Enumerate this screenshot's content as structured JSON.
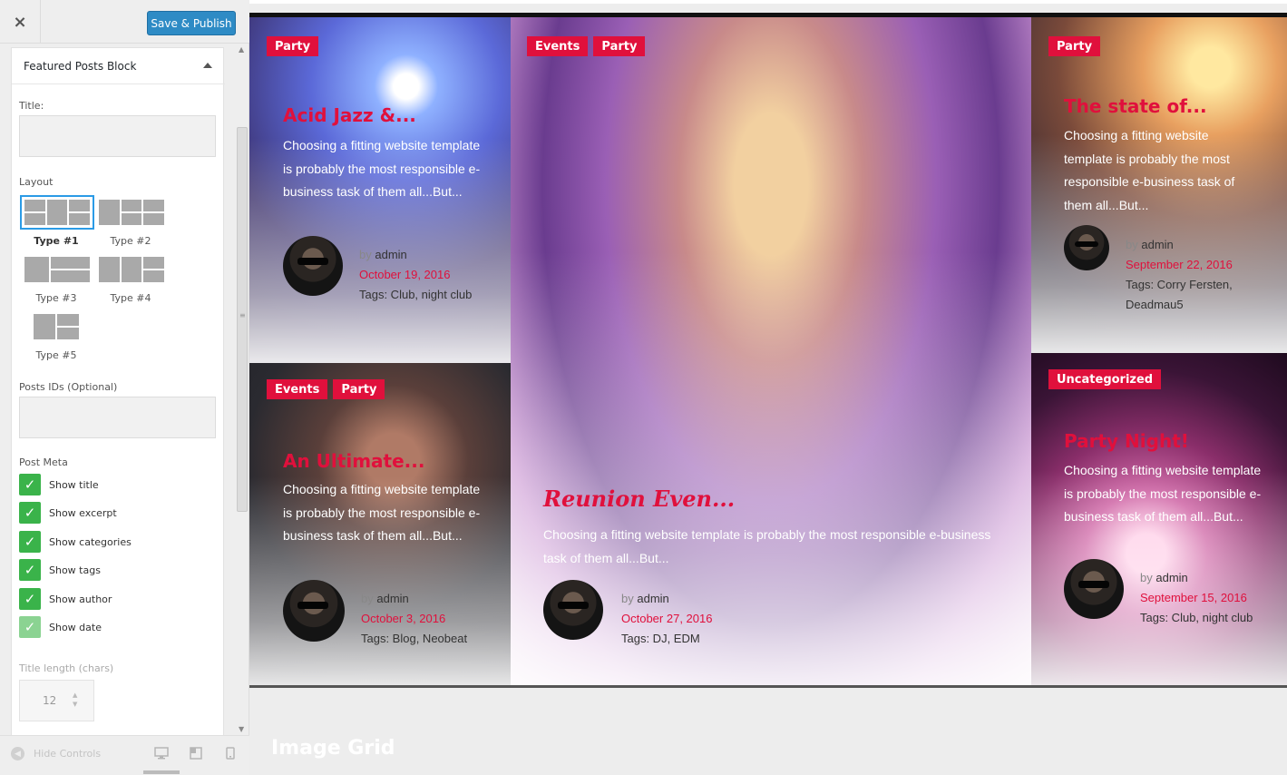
{
  "sidebar": {
    "close_label": "×",
    "publish_label": "Save & Publish",
    "block_title": "Featured Posts Block",
    "title_label": "Title:",
    "title_value": "",
    "layout_label": "Layout",
    "layout_options": [
      {
        "label": "Type #1",
        "selected": true
      },
      {
        "label": "Type #2",
        "selected": false
      },
      {
        "label": "Type #3",
        "selected": false
      },
      {
        "label": "Type #4",
        "selected": false
      },
      {
        "label": "Type #5",
        "selected": false
      }
    ],
    "posts_ids_label": "Posts IDs (Optional)",
    "posts_ids_value": "",
    "post_meta_label": "Post Meta",
    "checkboxes": [
      {
        "label": "Show title",
        "checked": true
      },
      {
        "label": "Show excerpt",
        "checked": true
      },
      {
        "label": "Show categories",
        "checked": true
      },
      {
        "label": "Show tags",
        "checked": true
      },
      {
        "label": "Show author",
        "checked": true
      },
      {
        "label": "Show date",
        "checked": true
      }
    ],
    "title_length_label": "Title length (chars)",
    "title_length_value": "12",
    "hide_controls_label": "Hide Controls",
    "devices": [
      "desktop-icon",
      "tablet-icon",
      "mobile-icon"
    ]
  },
  "colors": {
    "accent": "#e0103c",
    "publish": "#2e8bc5",
    "checkbox": "#3ab34a",
    "selected_outline": "#2b9be6"
  },
  "preview": {
    "section_title": "Image Grid",
    "posts": [
      {
        "categories": [
          "Party"
        ],
        "title": "Acid Jazz &...",
        "excerpt": "Choosing a fitting website template is probably the most responsible e-business task of them all...But...",
        "author": "admin",
        "by": "by",
        "date": "October 19, 2016",
        "tags": "Tags: Club, night club"
      },
      {
        "categories": [
          "Events",
          "Party"
        ],
        "title": "Reunion Even...",
        "excerpt": "Choosing a fitting website template is probably the most responsible e-business task of them all...But...",
        "author": "admin",
        "by": "by",
        "date": "October 27, 2016",
        "tags": "Tags: DJ, EDM"
      },
      {
        "categories": [
          "Party"
        ],
        "title": "The state of...",
        "excerpt": "Choosing a fitting website template is probably the most responsible e-business task of them all...But...",
        "author": "admin",
        "by": "by",
        "date": "September 22, 2016",
        "tags": "Tags: Corry Fersten, Deadmau5"
      },
      {
        "categories": [
          "Events",
          "Party"
        ],
        "title": "An Ultimate...",
        "excerpt": "Choosing a fitting website template is probably the most responsible e-business task of them all...But...",
        "author": "admin",
        "by": "by",
        "date": "October 3, 2016",
        "tags": "Tags: Blog, Neobeat"
      },
      {
        "categories": [
          "Uncategorized"
        ],
        "title": "Party Night!",
        "excerpt": "Choosing a fitting website template is probably the most responsible e-business task of them all...But...",
        "author": "admin",
        "by": "by",
        "date": "September 15, 2016",
        "tags": "Tags: Club, night club"
      }
    ]
  }
}
